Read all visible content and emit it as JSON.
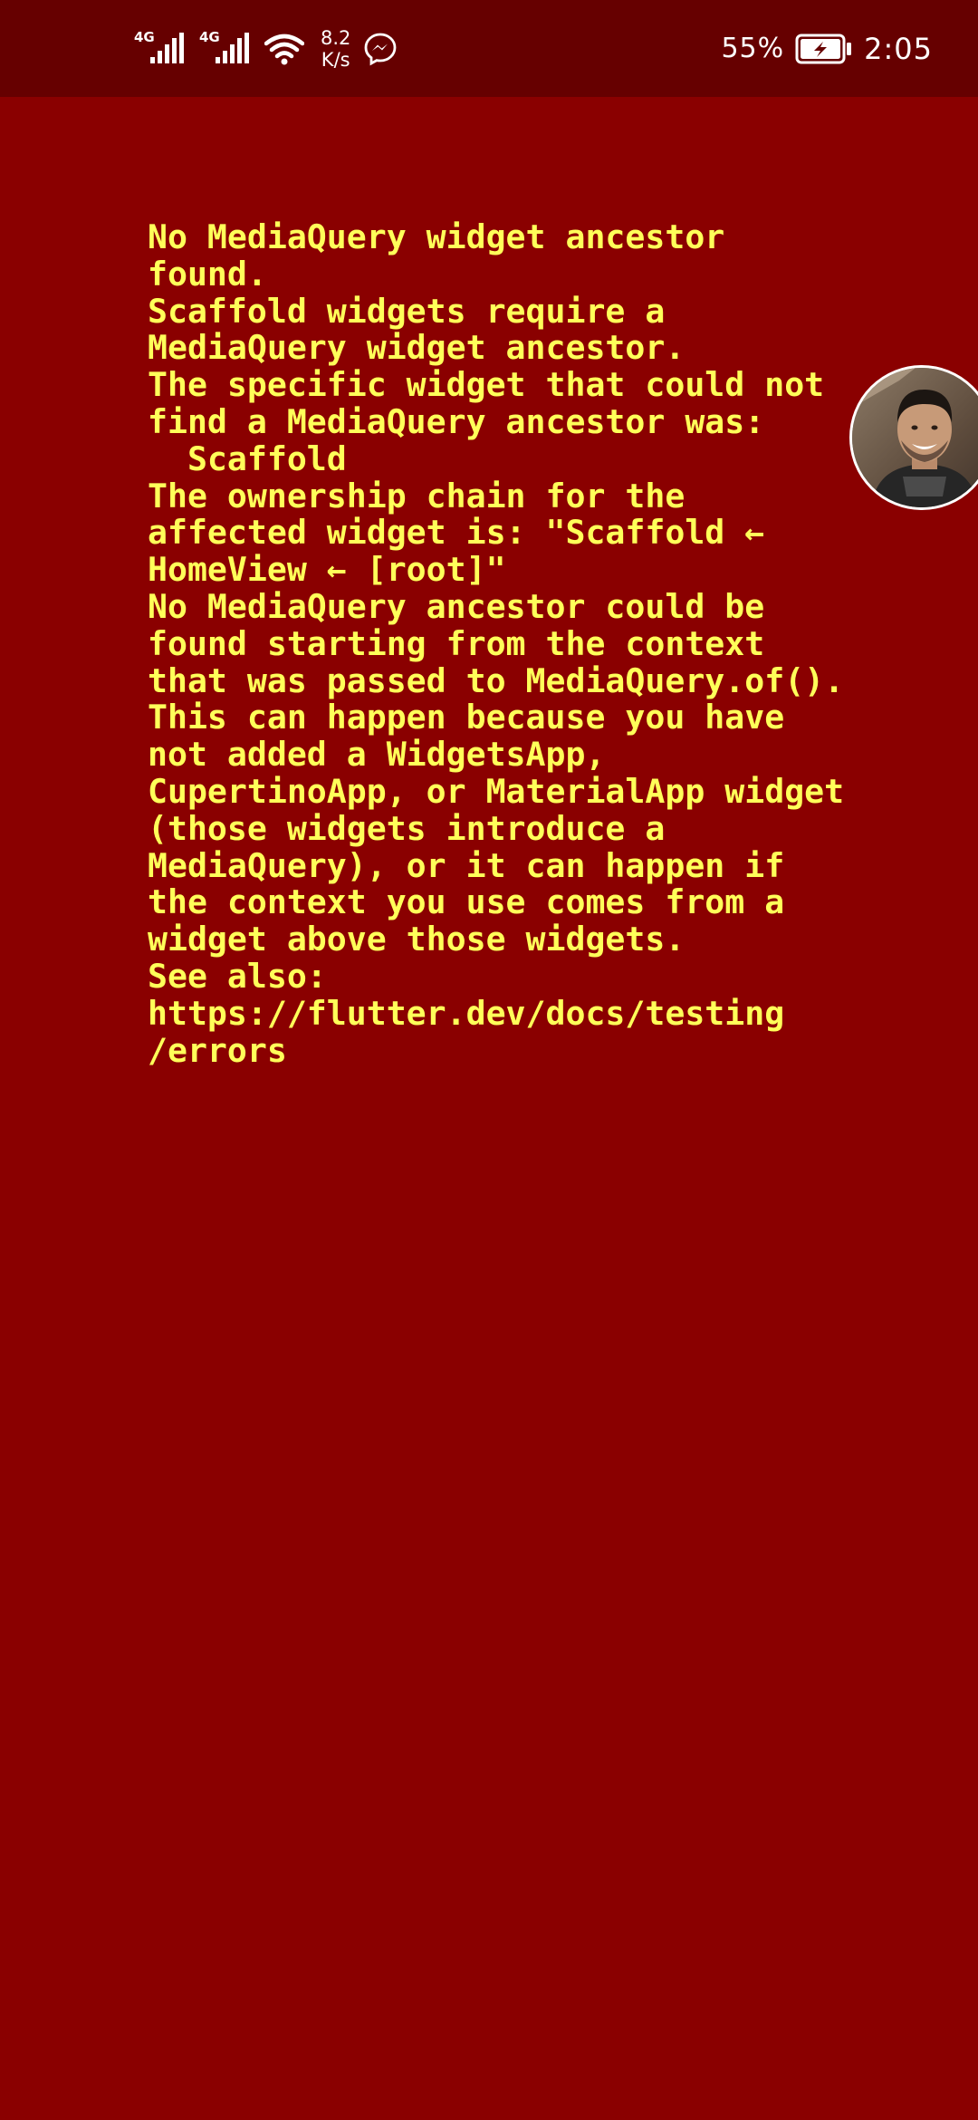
{
  "status_bar": {
    "network_1": "4G",
    "network_2": "4G",
    "speed_value": "8.2",
    "speed_unit": "K/s",
    "battery_percent": "55%",
    "time": "2:05",
    "icons": [
      "signal-icon",
      "signal-icon",
      "wifi-icon",
      "messenger-icon",
      "battery-charging-icon"
    ]
  },
  "error": {
    "lines": [
      "No MediaQuery widget ancestor",
      "found.",
      "Scaffold widgets require a",
      "MediaQuery widget ancestor.",
      "The specific widget that could not",
      "find a MediaQuery ancestor was:",
      "  Scaffold",
      "The ownership chain for the",
      "affected widget is: \"Scaffold ←",
      "HomeView ← [root]\"",
      "No MediaQuery ancestor could be",
      "found starting from the context",
      "that was passed to MediaQuery.of().",
      "This can happen because you have",
      "not added a WidgetsApp,",
      "CupertinoApp, or MaterialApp widget",
      "(those widgets introduce a",
      "MediaQuery), or it can happen if",
      "the context you use comes from a",
      "widget above those widgets.",
      "See also:",
      "https://flutter.dev/docs/testing",
      "/errors"
    ]
  },
  "colors": {
    "background": "#8a0000",
    "status_bar": "#660000",
    "error_text": "#ffff59"
  },
  "chat_head": {
    "icon": "profile-photo-avatar"
  }
}
